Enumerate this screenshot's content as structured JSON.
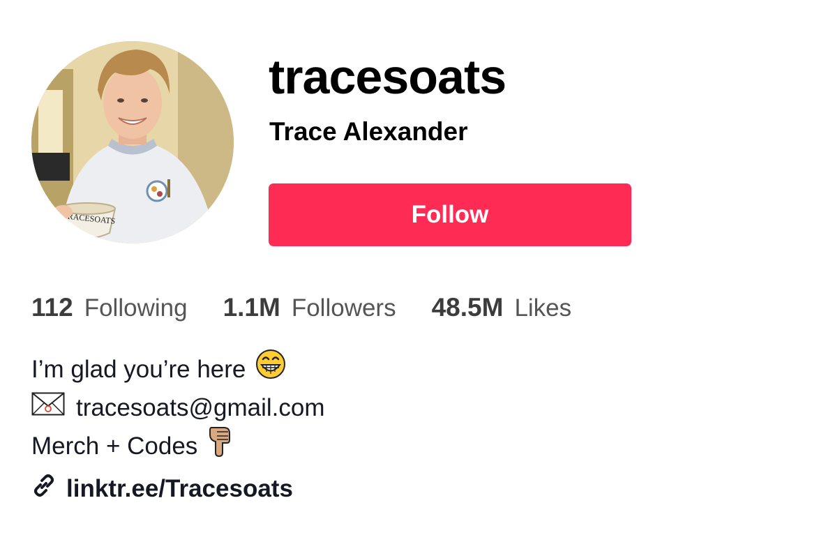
{
  "profile": {
    "username": "tracesoats",
    "display_name": "Trace Alexander",
    "avatar_alt": "avatar",
    "avatar_bowl_text": "TRACESOATS"
  },
  "actions": {
    "follow_label": "Follow"
  },
  "stats": [
    {
      "value": "112",
      "label": "Following"
    },
    {
      "value": "1.1M",
      "label": "Followers"
    },
    {
      "value": "48.5M",
      "label": "Likes"
    }
  ],
  "bio": {
    "line1": "I’m glad you’re here",
    "line2": "tracesoats@gmail.com",
    "line3": "Merch + Codes"
  },
  "link": {
    "text": "linktr.ee/Tracesoats"
  },
  "icons": {
    "grin": "grinning-face-icon",
    "mail": "envelope-icon",
    "pointing": "pointing-down-icon",
    "link": "link-icon"
  },
  "colors": {
    "follow_button": "#fe2c55",
    "text_primary": "#161823",
    "text_secondary": "#555555"
  }
}
